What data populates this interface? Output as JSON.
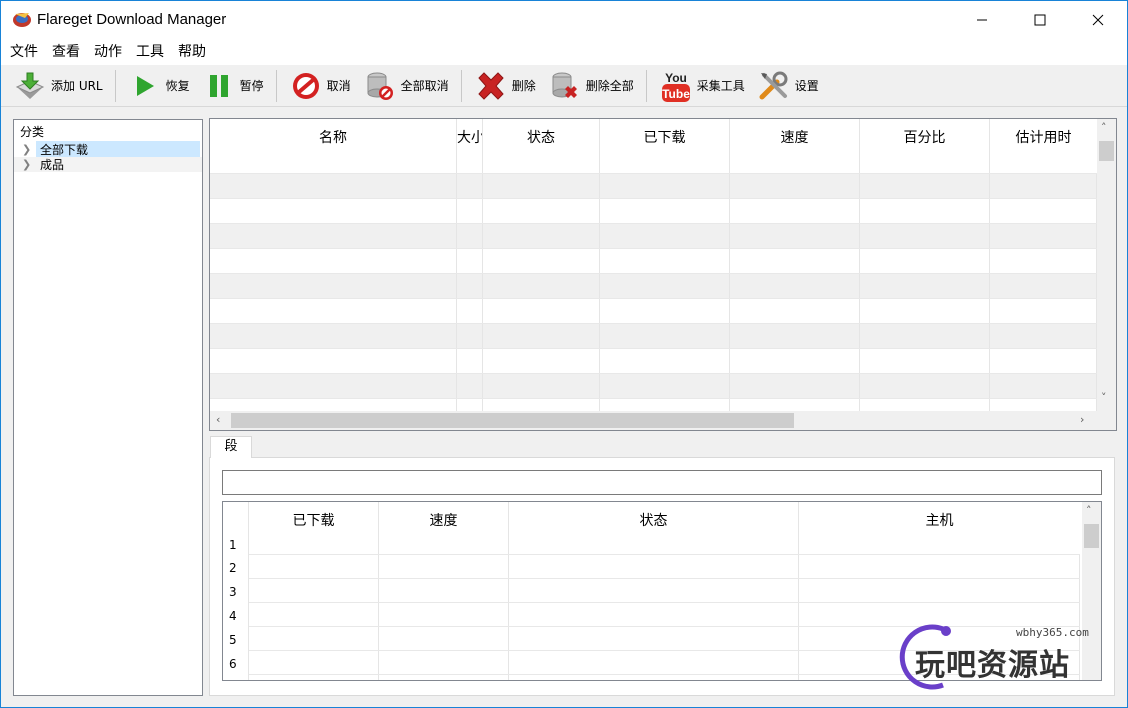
{
  "window": {
    "title": "Flareget Download Manager"
  },
  "menu": [
    "文件",
    "查看",
    "动作",
    "工具",
    "帮助"
  ],
  "toolbar": [
    {
      "label": "添加 URL",
      "icon": "add-url-icon"
    },
    {
      "label": "恢复",
      "icon": "play-icon"
    },
    {
      "label": "暂停",
      "icon": "pause-icon"
    },
    {
      "label": "取消",
      "icon": "cancel-icon"
    },
    {
      "label": "全部取消",
      "icon": "cancel-all-icon"
    },
    {
      "label": "删除",
      "icon": "delete-icon"
    },
    {
      "label": "删除全部",
      "icon": "delete-all-icon"
    },
    {
      "label": "采集工具",
      "icon": "youtube-icon"
    },
    {
      "label": "设置",
      "icon": "settings-tools-icon"
    }
  ],
  "tree": {
    "header": "分类",
    "items": [
      "全部下载",
      "成品"
    ]
  },
  "downloads": {
    "columns": [
      "名称",
      "大小",
      "状态",
      "已下载",
      "速度",
      "百分比",
      "估计用时"
    ],
    "rows": []
  },
  "tabs": {
    "segments": "段"
  },
  "segments": {
    "columns": [
      "已下载",
      "速度",
      "状态",
      "主机"
    ],
    "row_numbers": [
      "1",
      "2",
      "3",
      "4",
      "5",
      "6"
    ]
  },
  "watermark": {
    "url": "wbhy365.com",
    "text": "玩吧资源站"
  },
  "colors": {
    "accent": "#1883d7",
    "selection": "#cce8ff",
    "watermark": "#6a3fc9"
  }
}
